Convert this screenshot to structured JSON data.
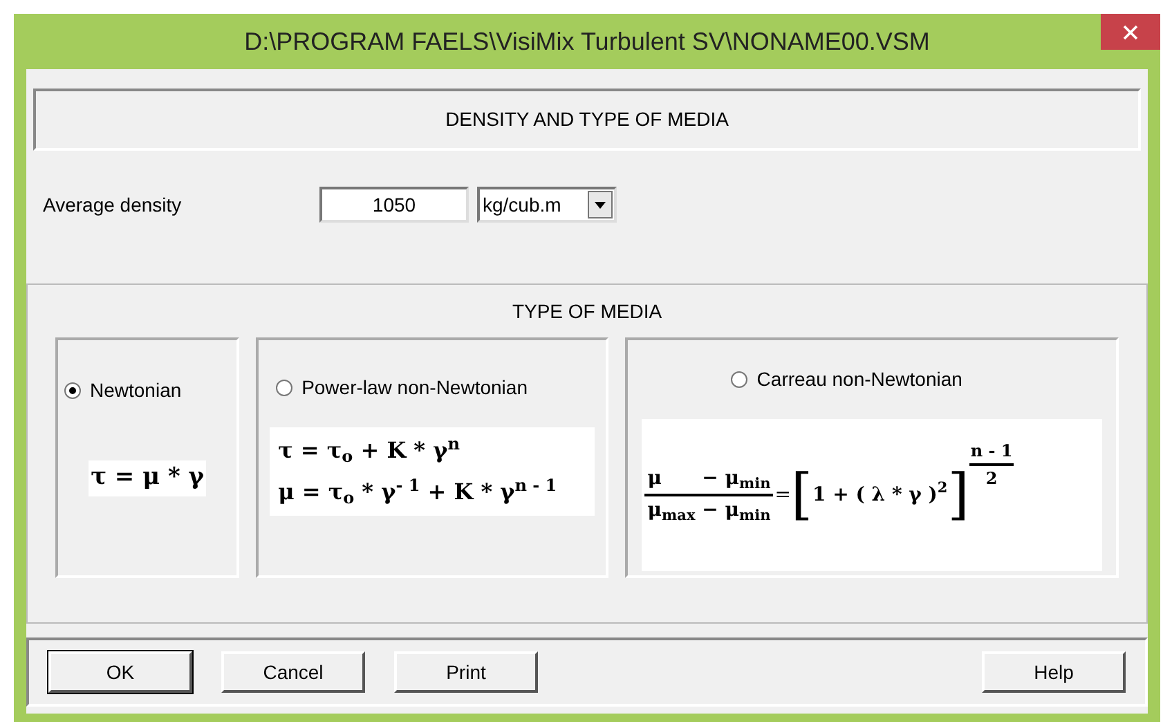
{
  "window": {
    "title": "D:\\PROGRAM FAELS\\VisiMix Turbulent SV\\NONAME00.VSM"
  },
  "header": "DENSITY AND TYPE OF MEDIA",
  "density": {
    "label": "Average density",
    "value": "1050",
    "unit": "kg/cub.m"
  },
  "media": {
    "title": "TYPE OF MEDIA",
    "options": [
      {
        "label": "Newtonian",
        "selected": true,
        "kind": "lines",
        "lines": [
          "τ = μ * γ"
        ]
      },
      {
        "label": "Power-law non-Newtonian",
        "selected": false,
        "kind": "lines",
        "lines": [
          "τ = τ$_{o}$ + K * γ$^{n}$",
          "μ = τ$_{o}$ * γ$^{- 1}$ + K * γ$^{n - 1}$"
        ]
      },
      {
        "label": "Carreau non-Newtonian",
        "selected": false,
        "kind": "fraction",
        "numerator": "μ",
        "numerator_rest": "− μ$_{min}$",
        "denominator": "μ$_{max}$ − μ$_{min}$",
        "equals": "=",
        "open": "[",
        "body": "1 + ( λ * γ )$^{2}$",
        "close": "]",
        "exp_numerator": "n - 1",
        "exp_denominator": "2"
      }
    ]
  },
  "buttons": [
    "OK",
    "Cancel",
    "Print",
    "Help"
  ]
}
